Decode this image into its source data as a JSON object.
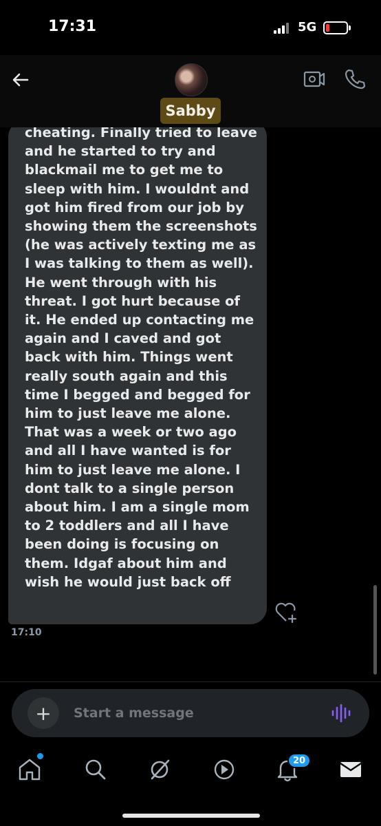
{
  "status_bar": {
    "time": "17:31",
    "network": "5G"
  },
  "header": {
    "contact_name": "Sabby"
  },
  "message": {
    "text": "cheating. Finally tried to leave and he started to try and blackmail me to get me to sleep with him. I wouldnt and got him fired from our job by showing them the screenshots (he was actively texting me as I was talking to them as well). He went through with his threat. I got hurt because of it. He ended up contacting me again and I caved and got back with him. Things went really south again and this time I begged and begged for him to just leave me alone. That was a week or two ago and all I have wanted is for him to just leave me alone. I dont talk to a single person about him. I am a single mom to 2 toddlers and all I have been doing is focusing on them. Idgaf about him and wish he would just back off",
    "time": "17:10"
  },
  "composer": {
    "placeholder": "Start a message"
  },
  "nav": {
    "notifications_count": "20"
  },
  "colors": {
    "accent": "#1d9bf0",
    "bubble": "#2f3336",
    "name_highlight": "#5d4a15",
    "voice_icon": "#8b5cf6"
  }
}
